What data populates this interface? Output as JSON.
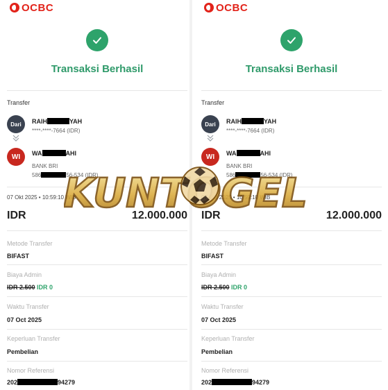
{
  "brand": {
    "name": "OCBC",
    "color": "#e2231a"
  },
  "receipt": {
    "title": "Transaksi Berhasil",
    "transfer_label": "Transfer",
    "from": {
      "avatar": "Dari",
      "name_prefix": "RAIH",
      "name_suffix": "YAH",
      "account": "****-****-7664 (IDR)"
    },
    "to": {
      "avatar": "WI",
      "name_prefix": "WA",
      "name_suffix": "AHI",
      "bank": "BANK BRI",
      "account_prefix": "586",
      "account_suffix": "56-534 (IDR)"
    },
    "datetime": "07 Okt 2025 • 10:59:10 WIB",
    "currency": "IDR",
    "amount": "12.000.000",
    "fields": {
      "method_label": "Metode Transfer",
      "method_value": "BIFAST",
      "fee_label": "Biaya Admin",
      "fee_original": "IDR 2.500",
      "fee_value": "IDR 0",
      "time_label": "Waktu Transfer",
      "time_value": "07 Oct 2025",
      "purpose_label": "Keperluan Transfer",
      "purpose_value": "Pembelian",
      "ref_label": "Nomor Referensi",
      "ref_prefix": "202",
      "ref_suffix": "94279"
    },
    "colors": {
      "success": "#2ea36b",
      "accent_red": "#c8281f",
      "dark_avatar": "#3a4250"
    }
  },
  "watermark": {
    "text": "KUNTOGEL"
  },
  "icons": {
    "success": "checkmark-icon",
    "chevron": "chevron-double-down-icon",
    "ball": "soccer-ball-icon"
  }
}
